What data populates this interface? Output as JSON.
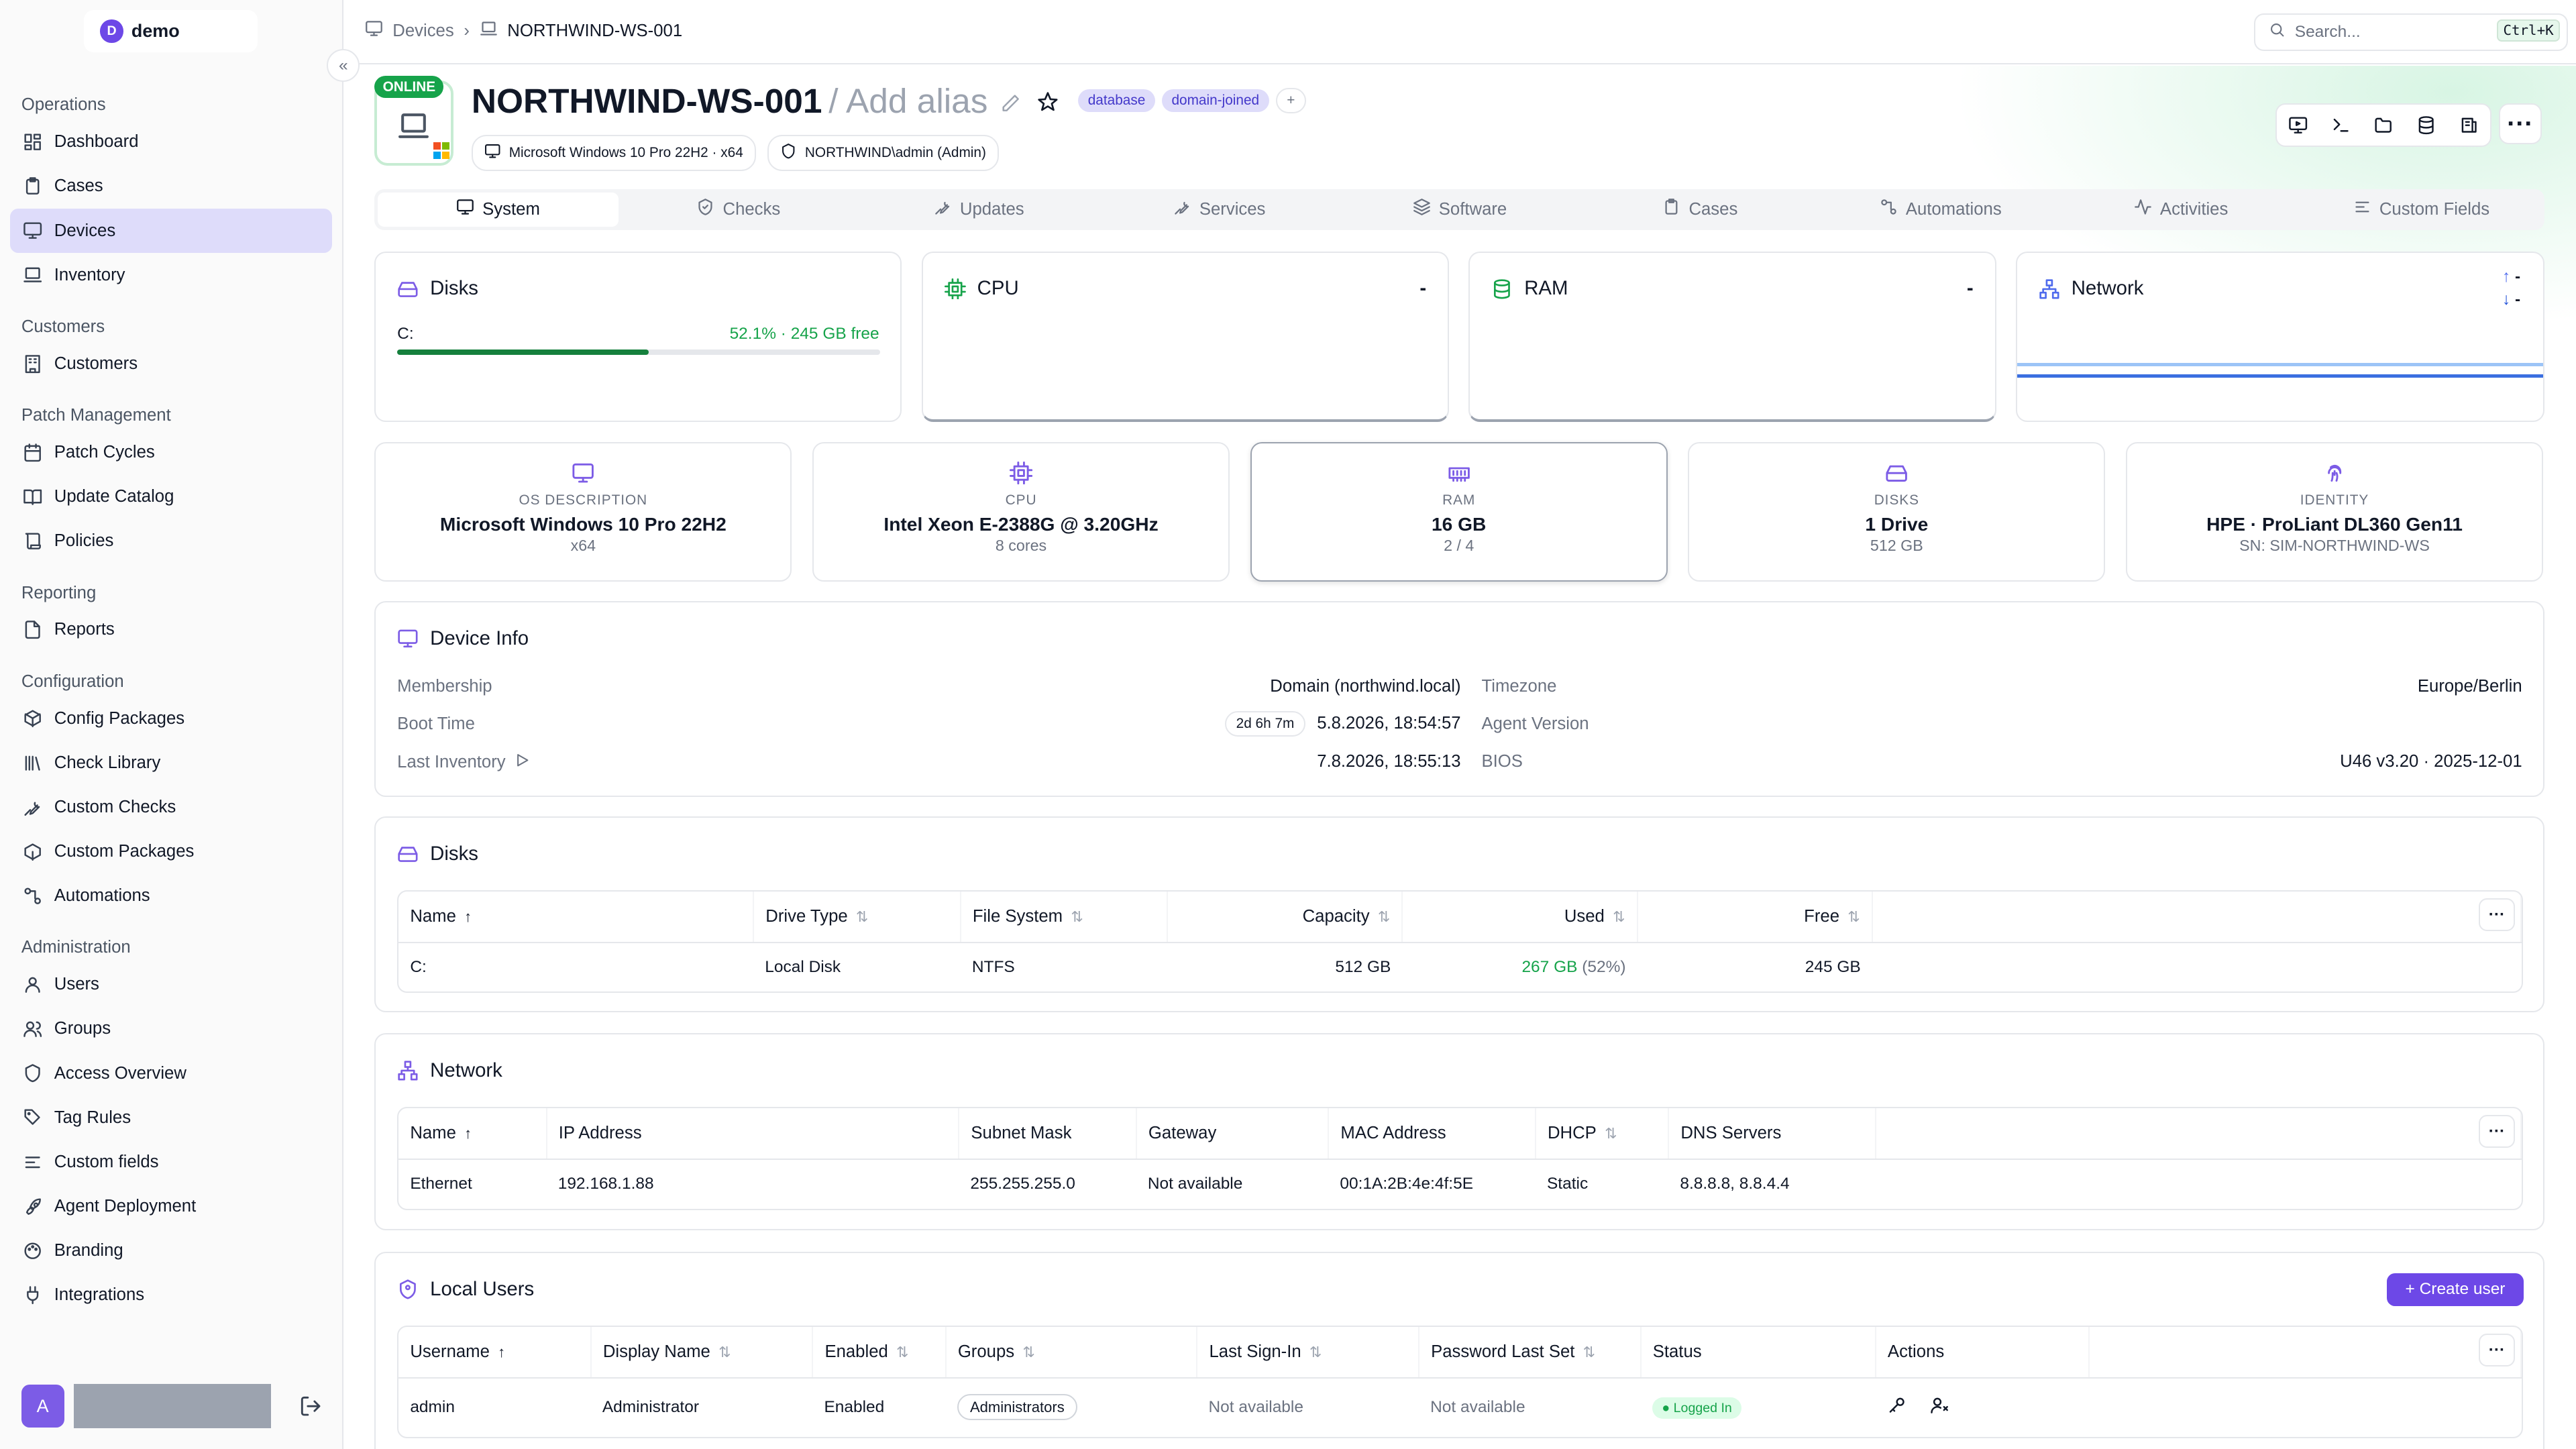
{
  "org": {
    "name": "demo",
    "initial": "D"
  },
  "nav": {
    "s1": "Operations",
    "dashboard": "Dashboard",
    "cases": "Cases",
    "devices": "Devices",
    "inventory": "Inventory",
    "s2": "Customers",
    "customers": "Customers",
    "s3": "Patch Management",
    "patch_cycles": "Patch Cycles",
    "update_catalog": "Update Catalog",
    "policies": "Policies",
    "s4": "Reporting",
    "reports": "Reports",
    "s5": "Configuration",
    "config_packages": "Config Packages",
    "check_library": "Check Library",
    "custom_checks": "Custom Checks",
    "custom_packages": "Custom Packages",
    "automations": "Automations",
    "s6": "Administration",
    "users": "Users",
    "groups": "Groups",
    "access_overview": "Access Overview",
    "tag_rules": "Tag Rules",
    "custom_fields": "Custom fields",
    "agent_deployment": "Agent Deployment",
    "branding": "Branding",
    "integrations": "Integrations"
  },
  "user": {
    "initial": "A"
  },
  "breadcrumb": {
    "root": "Devices",
    "current": "NORTHWIND-WS-001"
  },
  "search": {
    "placeholder": "Search...",
    "shortcut": "Ctrl+K"
  },
  "device": {
    "status": "ONLINE",
    "name": "NORTHWIND-WS-001",
    "alias": "/ Add alias",
    "tags": [
      "database",
      "domain-joined"
    ],
    "add_tag": "+",
    "os_pill": "Microsoft Windows 10 Pro 22H2 · x64",
    "user_pill": "NORTHWIND\\admin (Admin)"
  },
  "tabs": [
    "System",
    "Checks",
    "Updates",
    "Services",
    "Software",
    "Cases",
    "Automations",
    "Activities",
    "Custom Fields"
  ],
  "metrics": {
    "disks": {
      "title": "Disks",
      "drive": "C:",
      "usage": "52.1% · 245 GB free",
      "percent": 52.1
    },
    "cpu": {
      "title": "CPU",
      "value": "-"
    },
    "ram": {
      "title": "RAM",
      "value": "-"
    },
    "network": {
      "title": "Network",
      "up": "-",
      "down": "-"
    }
  },
  "summary": [
    {
      "label": "OS DESCRIPTION",
      "value": "Microsoft Windows 10 Pro 22H2",
      "sub": "x64"
    },
    {
      "label": "CPU",
      "value": "Intel Xeon E-2388G @ 3.20GHz",
      "sub": "8 cores"
    },
    {
      "label": "RAM",
      "value": "16 GB",
      "sub": "2 / 4"
    },
    {
      "label": "DISKS",
      "value": "1 Drive",
      "sub": "512 GB"
    },
    {
      "label": "IDENTITY",
      "value": "HPE · ProLiant DL360 Gen11",
      "sub": "SN: SIM-NORTHWIND-WS"
    }
  ],
  "device_info": {
    "title": "Device Info",
    "membership_k": "Membership",
    "membership_v": "Domain (northwind.local)",
    "boot_k": "Boot Time",
    "boot_badge": "2d 6h 7m",
    "boot_v": "5.8.2026, 18:54:57",
    "inv_k": "Last Inventory",
    "inv_v": "7.8.2026, 18:55:13",
    "tz_k": "Timezone",
    "tz_v": "Europe/Berlin",
    "agent_k": "Agent Version",
    "agent_v": "",
    "bios_k": "BIOS",
    "bios_v": "U46 v3.20 · 2025-12-01"
  },
  "disks_table": {
    "title": "Disks",
    "headers": [
      "Name",
      "Drive Type",
      "File System",
      "Capacity",
      "Used",
      "Free"
    ],
    "row": {
      "name": "C:",
      "type": "Local Disk",
      "fs": "NTFS",
      "capacity": "512 GB",
      "used": "267 GB",
      "used_pct": "(52%)",
      "free": "245 GB"
    }
  },
  "network_table": {
    "title": "Network",
    "headers": [
      "Name",
      "IP Address",
      "Subnet Mask",
      "Gateway",
      "MAC Address",
      "DHCP",
      "DNS Servers"
    ],
    "row": {
      "name": "Ethernet",
      "ip": "192.168.1.88",
      "mask": "255.255.255.0",
      "gw": "Not available",
      "mac": "00:1A:2B:4e:4f:5E",
      "dhcp": "Static",
      "dns": "8.8.8.8, 8.8.4.4"
    }
  },
  "users_table": {
    "title": "Local Users",
    "create": "+ Create user",
    "headers": [
      "Username",
      "Display Name",
      "Enabled",
      "Groups",
      "Last Sign-In",
      "Password Last Set",
      "Status",
      "Actions"
    ],
    "row": {
      "username": "admin",
      "display": "Administrator",
      "enabled": "Enabled",
      "groups": "Administrators",
      "last": "Not available",
      "pw": "Not available",
      "status": "Logged In"
    }
  },
  "colors": {
    "accent": "#6d48e7",
    "online": "#16a34a"
  }
}
